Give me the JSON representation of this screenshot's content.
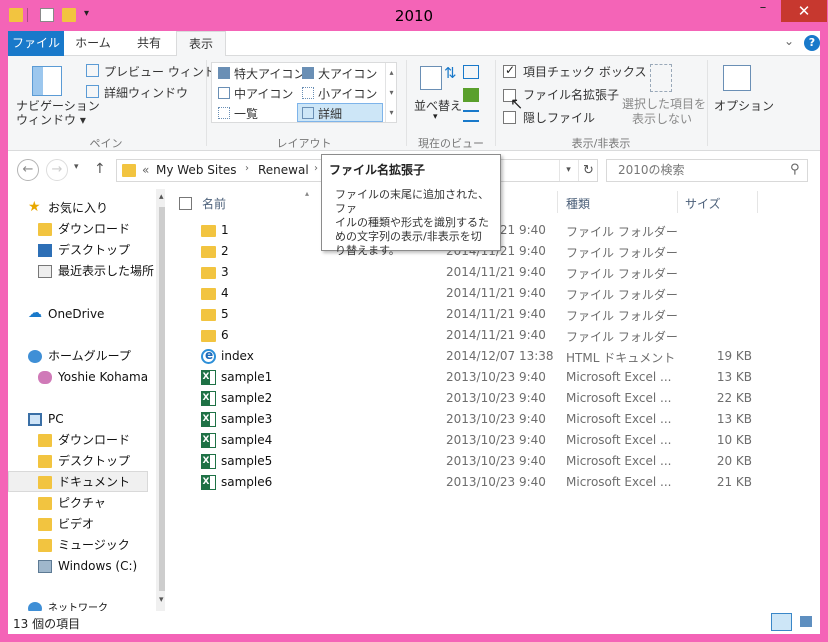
{
  "window": {
    "title": "2010",
    "minimize": "–",
    "maximize": "□",
    "close": "✕"
  },
  "ribbon_tabs": [
    "ファイル",
    "ホーム",
    "共有",
    "表示"
  ],
  "help": "?",
  "ribbon": {
    "pane": {
      "nav_pane_line1": "ナビゲーション",
      "nav_pane_line2": "ウィンドウ ▾",
      "preview": "プレビュー ウィンドウ",
      "details": "詳細ウィンドウ",
      "label": "ペイン"
    },
    "layout": {
      "items": [
        "特大アイコン",
        "大アイコン",
        "中アイコン",
        "小アイコン",
        "一覧",
        "詳細"
      ],
      "label": "レイアウト"
    },
    "current_view": {
      "sort_line1": "並べ替え",
      "label": "現在のビュー"
    },
    "show_hide": {
      "item_checkboxes": "項目チェック ボックス",
      "file_extensions": "ファイル名拡張子",
      "hidden_items": "隠しファイル",
      "hide_selected_line1": "選択した項目を",
      "hide_selected_line2": "表示しない",
      "label": "表示/非表示"
    },
    "options": "オプション"
  },
  "address": {
    "prefix": "«",
    "crumbs": [
      "My Web Sites",
      "Renewal"
    ],
    "search_placeholder": "2010の検索"
  },
  "tooltip": {
    "title": "ファイル名拡張子",
    "body_line1": "ファイルの末尾に追加された、ファ",
    "body_line2": "イルの種類や形式を識別するた",
    "body_line3": "めの文字列の表示/非表示を切",
    "body_line4": "り替えます。"
  },
  "nav_pane": {
    "favorites": "お気に入り",
    "fav_items": [
      "ダウンロード",
      "デスクトップ",
      "最近表示した場所"
    ],
    "onedrive": "OneDrive",
    "homegroup": "ホームグループ",
    "homegroup_user": "Yoshie Kohama",
    "pc": "PC",
    "pc_items": [
      "ダウンロード",
      "デスクトップ",
      "ドキュメント",
      "ピクチャ",
      "ビデオ",
      "ミュージック",
      "Windows (C:)"
    ],
    "network": "ネットワーク"
  },
  "columns": {
    "name": "名前",
    "type": "種類",
    "size": "サイズ"
  },
  "files": [
    {
      "name": "1",
      "date": "2014/11/21 9:40",
      "type": "ファイル フォルダー",
      "size": "",
      "icon": "folder"
    },
    {
      "name": "2",
      "date": "2014/11/21 9:40",
      "type": "ファイル フォルダー",
      "size": "",
      "icon": "folder"
    },
    {
      "name": "3",
      "date": "2014/11/21 9:40",
      "type": "ファイル フォルダー",
      "size": "",
      "icon": "folder"
    },
    {
      "name": "4",
      "date": "2014/11/21 9:40",
      "type": "ファイル フォルダー",
      "size": "",
      "icon": "folder"
    },
    {
      "name": "5",
      "date": "2014/11/21 9:40",
      "type": "ファイル フォルダー",
      "size": "",
      "icon": "folder"
    },
    {
      "name": "6",
      "date": "2014/11/21 9:40",
      "type": "ファイル フォルダー",
      "size": "",
      "icon": "folder"
    },
    {
      "name": "index",
      "date": "2014/12/07 13:38",
      "type": "HTML ドキュメント",
      "size": "19 KB",
      "icon": "ie"
    },
    {
      "name": "sample1",
      "date": "2013/10/23 9:40",
      "type": "Microsoft Excel ...",
      "size": "13 KB",
      "icon": "excel"
    },
    {
      "name": "sample2",
      "date": "2013/10/23 9:40",
      "type": "Microsoft Excel ...",
      "size": "22 KB",
      "icon": "excel"
    },
    {
      "name": "sample3",
      "date": "2013/10/23 9:40",
      "type": "Microsoft Excel ...",
      "size": "13 KB",
      "icon": "excel"
    },
    {
      "name": "sample4",
      "date": "2013/10/23 9:40",
      "type": "Microsoft Excel ...",
      "size": "10 KB",
      "icon": "excel"
    },
    {
      "name": "sample5",
      "date": "2013/10/23 9:40",
      "type": "Microsoft Excel ...",
      "size": "20 KB",
      "icon": "excel"
    },
    {
      "name": "sample6",
      "date": "2013/10/23 9:40",
      "type": "Microsoft Excel ...",
      "size": "21 KB",
      "icon": "excel"
    }
  ],
  "status": "13 個の項目",
  "colors": {
    "frame": "#f464b7",
    "accent": "#1979ca",
    "close": "#c7382f"
  }
}
